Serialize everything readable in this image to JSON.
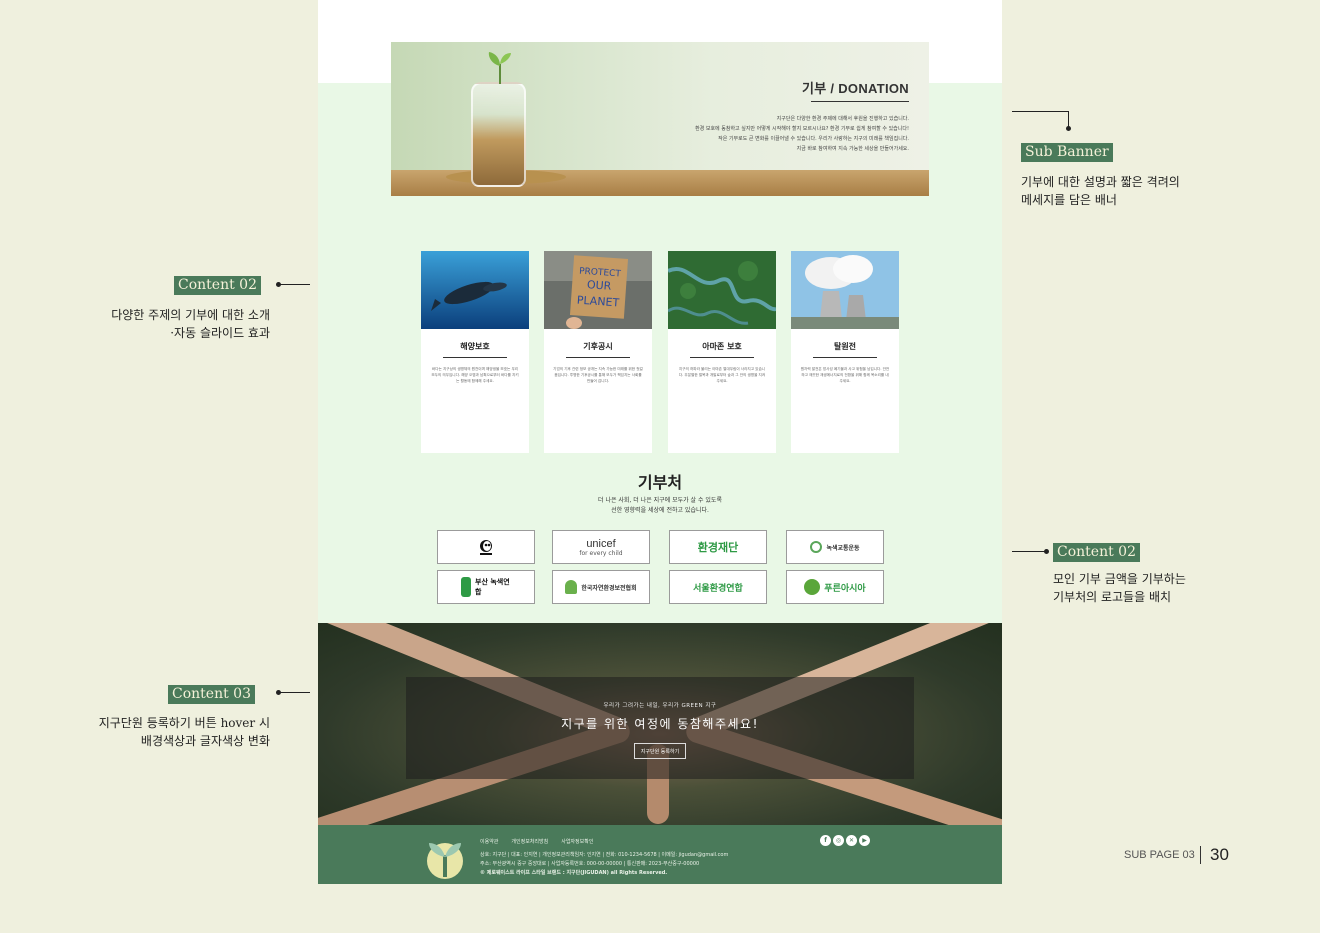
{
  "annotations": {
    "sub_banner": {
      "tag": "Sub Banner",
      "desc_line1": "기부에 대한 설명과 짧은 격려의",
      "desc_line2": "메세지를 담은 배너"
    },
    "content02_left": {
      "tag": "Content 02",
      "desc_line1": "다양한 주제의 기부에 대한 소개",
      "desc_line2": "·자동 슬라이드 효과"
    },
    "content02_right": {
      "tag": "Content 02",
      "desc_line1": "모인 기부 금액을 기부하는",
      "desc_line2": "기부처의 로고들을 배치"
    },
    "content03": {
      "tag": "Content 03",
      "desc_line1": "지구단원 등록하기 버튼 hover 시",
      "desc_line2": "배경색상과 글자색상 변화"
    }
  },
  "banner": {
    "title": "기부 / DONATION",
    "lines": [
      "지구단은 다양한 환경 주제에 대해서 후원을 진행하고 있습니다.",
      "환경 보호에 동참하고 싶지만 어떻게 시작해야 할지 모르시나요? 환경 기부로 쉽게 참여할 수 있습니다!",
      "작은 기부로도 큰 변화를 이끌어낼 수 있습니다. 우리가 사랑하는 지구의 미래를 책임집니다.",
      "지금 바로 참여하여 지속 가능한 세상을 만들어가세요."
    ]
  },
  "cards": [
    {
      "title": "해양보호",
      "text": "바다는 지구상의 생명체의 원천이며 해양생물 보호는 우리 모두의 의무입니다. 해양 오염과 남획으로부터 바다를 지키는 활동에 함께해 주세요."
    },
    {
      "title": "기후공시",
      "text": "기업의 기후 관련 정보 공개는 지속 가능한 미래를 위한 첫걸음입니다. 투명한 기후공시를 통해 모두가 책임지는 사회를 만들어 갑니다."
    },
    {
      "title": "아마존 보호",
      "text": "지구의 허파라 불리는 아마존 열대우림이 사라지고 있습니다. 무분별한 벌목과 개발로부터 숲과 그 안의 생명을 지켜 주세요."
    },
    {
      "title": "탈원전",
      "text": "원자력 발전은 방사성 폐기물과 사고 위험을 남깁니다. 안전하고 깨끗한 재생에너지로의 전환을 위해 함께 목소리를 내 주세요."
    }
  ],
  "donors": {
    "title": "기부처",
    "desc_line1": "더 나은 사회, 더 나은 지구에 모두가 살 수 있도록",
    "desc_line2": "선한 영향력을 세상에 전하고 있습니다.",
    "logos": [
      {
        "name": "WWF",
        "color": "#111111"
      },
      {
        "name": "unicef",
        "sub": "for every child",
        "color": "#333333"
      },
      {
        "name": "환경재단",
        "color": "#2e9a45"
      },
      {
        "name": "녹색교통운동",
        "color": "#333333"
      },
      {
        "name": "부산 녹색연합",
        "color": "#2e9a45"
      },
      {
        "name": "한국자연환경보전협회",
        "color": "#333333"
      },
      {
        "name": "서울환경연합",
        "color": "#2e9a45"
      },
      {
        "name": "푸른아시아",
        "color": "#2e9a45"
      }
    ]
  },
  "join": {
    "subtitle": "우리가 그려가는 내일, 우리가 GREEN 지구",
    "title": "지구를 위한 여정에 동참해주세요!",
    "button": "지구단원 등록하기"
  },
  "footer": {
    "links": [
      "이용약관",
      "개인정보처리방침",
      "사업자정보확인"
    ],
    "info_line1": "상호: 지구단 | 대표: 인지연 | 개인정보관리책임자: 인지연 | 전화: 010-1234-5678 | 이메일: jigudan@gmail.com",
    "info_line2": "주소: 부산광역시 중구 중앙대로 | 사업자등록번호: 000-00-00000 | 통신판매: 2023-부산중구-00000",
    "info_line3": "© 제로웨이스트 라이프 스타일 브랜드 : 지구단(JIGUDAN) all Rights Reserved."
  },
  "page": {
    "label": "SUB PAGE 03",
    "number": "30"
  },
  "colors": {
    "accent": "#4a7a5a",
    "page_bg": "#eff0de",
    "content_bg": "#e9f8e6"
  }
}
